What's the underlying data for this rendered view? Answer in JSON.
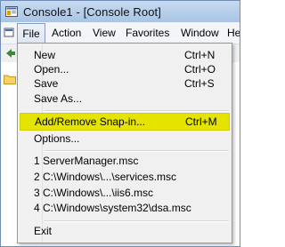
{
  "window": {
    "title": "Console1 - [Console Root]"
  },
  "menubar": {
    "file": "File",
    "action": "Action",
    "view": "View",
    "favorites": "Favorites",
    "window": "Window",
    "help": "He"
  },
  "file_menu": {
    "new": {
      "label": "New",
      "shortcut": "Ctrl+N"
    },
    "open": {
      "label": "Open...",
      "shortcut": "Ctrl+O"
    },
    "save": {
      "label": "Save",
      "shortcut": "Ctrl+S"
    },
    "save_as": {
      "label": "Save As..."
    },
    "add_remove": {
      "label": "Add/Remove Snap-in...",
      "shortcut": "Ctrl+M"
    },
    "options": {
      "label": "Options..."
    },
    "recent": [
      "1 ServerManager.msc",
      "2 C:\\Windows\\...\\services.msc",
      "3 C:\\Windows\\...\\iis6.msc",
      "4 C:\\Windows\\system32\\dsa.msc"
    ],
    "exit": {
      "label": "Exit"
    }
  },
  "colors": {
    "highlight": "#e5e300",
    "title_bar": "#b8d0ec"
  },
  "icons": {
    "title": "mmc-console-icon",
    "toolbar_back": "back-arrow-icon",
    "tree": "folder-icon"
  }
}
